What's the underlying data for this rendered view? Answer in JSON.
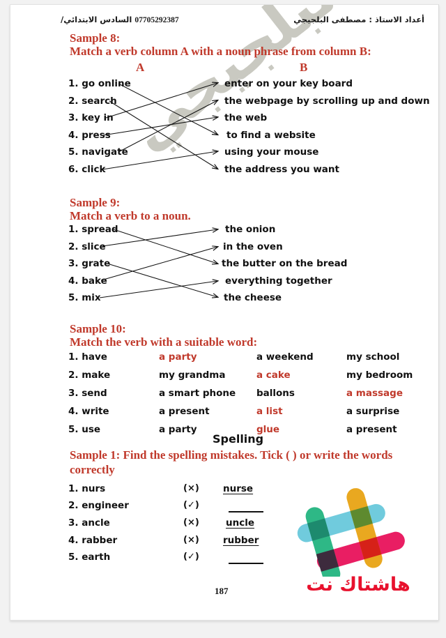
{
  "document": {
    "header_right": "أعداد الاستاذ : مصطفى البلجيجي",
    "header_left_arabic": "السادس الابتدائي/",
    "header_left_phone": "07705292387",
    "watermark": "مصطفى البلجيجي",
    "page_number": "187"
  },
  "sample8": {
    "title": "Sample 8:",
    "instruction": "Match a verb column A with a noun phrase from column B:",
    "column_a_label": "A",
    "column_b_label": "B",
    "column_a": [
      "1. go online",
      "2. search",
      "3. key in",
      "4. press",
      "5. navigate",
      "6. click"
    ],
    "column_b": [
      "enter on your key board",
      "the webpage by scrolling up and down",
      "the web",
      "to find a website",
      "using your mouse",
      "the address you want"
    ],
    "matches": [
      {
        "from": 1,
        "to": 4
      },
      {
        "from": 2,
        "to": 6
      },
      {
        "from": 3,
        "to": 1
      },
      {
        "from": 4,
        "to": 3
      },
      {
        "from": 5,
        "to": 2
      },
      {
        "from": 6,
        "to": 5
      }
    ]
  },
  "sample9": {
    "title": "Sample 9:",
    "instruction": "Match a verb to a noun.",
    "column_a": [
      "1. spread",
      "2. slice",
      "3. grate",
      "4. bake",
      "5. mix"
    ],
    "column_b": [
      "the onion",
      "in the oven",
      "the butter on the bread",
      "everything together",
      "the cheese"
    ],
    "matches": [
      {
        "from": 1,
        "to": 3
      },
      {
        "from": 2,
        "to": 1
      },
      {
        "from": 3,
        "to": 5
      },
      {
        "from": 4,
        "to": 2
      },
      {
        "from": 5,
        "to": 4
      }
    ]
  },
  "sample10": {
    "title": "Sample 10:",
    "instruction": "Match the verb with a suitable word:",
    "rows": [
      {
        "verb": "1. have",
        "c1": "a party",
        "c1_red": true,
        "c2": "a weekend",
        "c2_red": false,
        "c3": "my school",
        "c3_red": false
      },
      {
        "verb": "2. make",
        "c1": "my grandma",
        "c1_red": false,
        "c2": "a cake",
        "c2_red": true,
        "c3": "my bedroom",
        "c3_red": false
      },
      {
        "verb": "3. send",
        "c1": "a smart phone",
        "c1_red": false,
        "c2": "ballons",
        "c2_red": false,
        "c3": "a massage",
        "c3_red": true
      },
      {
        "verb": "4. write",
        "c1": "a present",
        "c1_red": false,
        "c2": "a list",
        "c2_red": true,
        "c3": "a surprise",
        "c3_red": false
      },
      {
        "verb": "5. use",
        "c1": "a party",
        "c1_red": false,
        "c2": "glue",
        "c2_red": true,
        "c3": "a present",
        "c3_red": false
      }
    ]
  },
  "spelling": {
    "section_title": "Spelling",
    "sample_label": "Sample 1:",
    "instruction": "Find the spelling mistakes. Tick ( ) or write the words",
    "instruction_line2": "correctly",
    "rows": [
      {
        "word": "1. nurs",
        "mark": "(×)",
        "correction": "nurse",
        "blank": false
      },
      {
        "word": "2. engineer",
        "mark": "(✓)",
        "correction": "",
        "blank": true
      },
      {
        "word": "3. ancle",
        "mark": "(×)",
        "correction": "uncle",
        "blank": false
      },
      {
        "word": "4. rabber",
        "mark": "(×)",
        "correction": "rubber",
        "blank": false
      },
      {
        "word": "5. earth",
        "mark": "(✓)",
        "correction": "",
        "blank": true
      }
    ]
  },
  "logo": {
    "brand_text": "هاشتاك نت",
    "brand_color": "#e8112d",
    "bar_colors": {
      "green": "#2eb886",
      "cyan": "#70cbdd",
      "yellow": "#e9a820",
      "pink": "#e91e63",
      "dark_overlap": "#3d2b3d",
      "red_overlap": "#d62118",
      "olive_overlap": "#5e8a2f",
      "teal_overlap": "#1d8a6e"
    }
  },
  "theme": {
    "heading_red": "#c0392b",
    "body_black": "#111111",
    "watermark_gray": "#b5b5aa",
    "paper_white": "#ffffff"
  }
}
